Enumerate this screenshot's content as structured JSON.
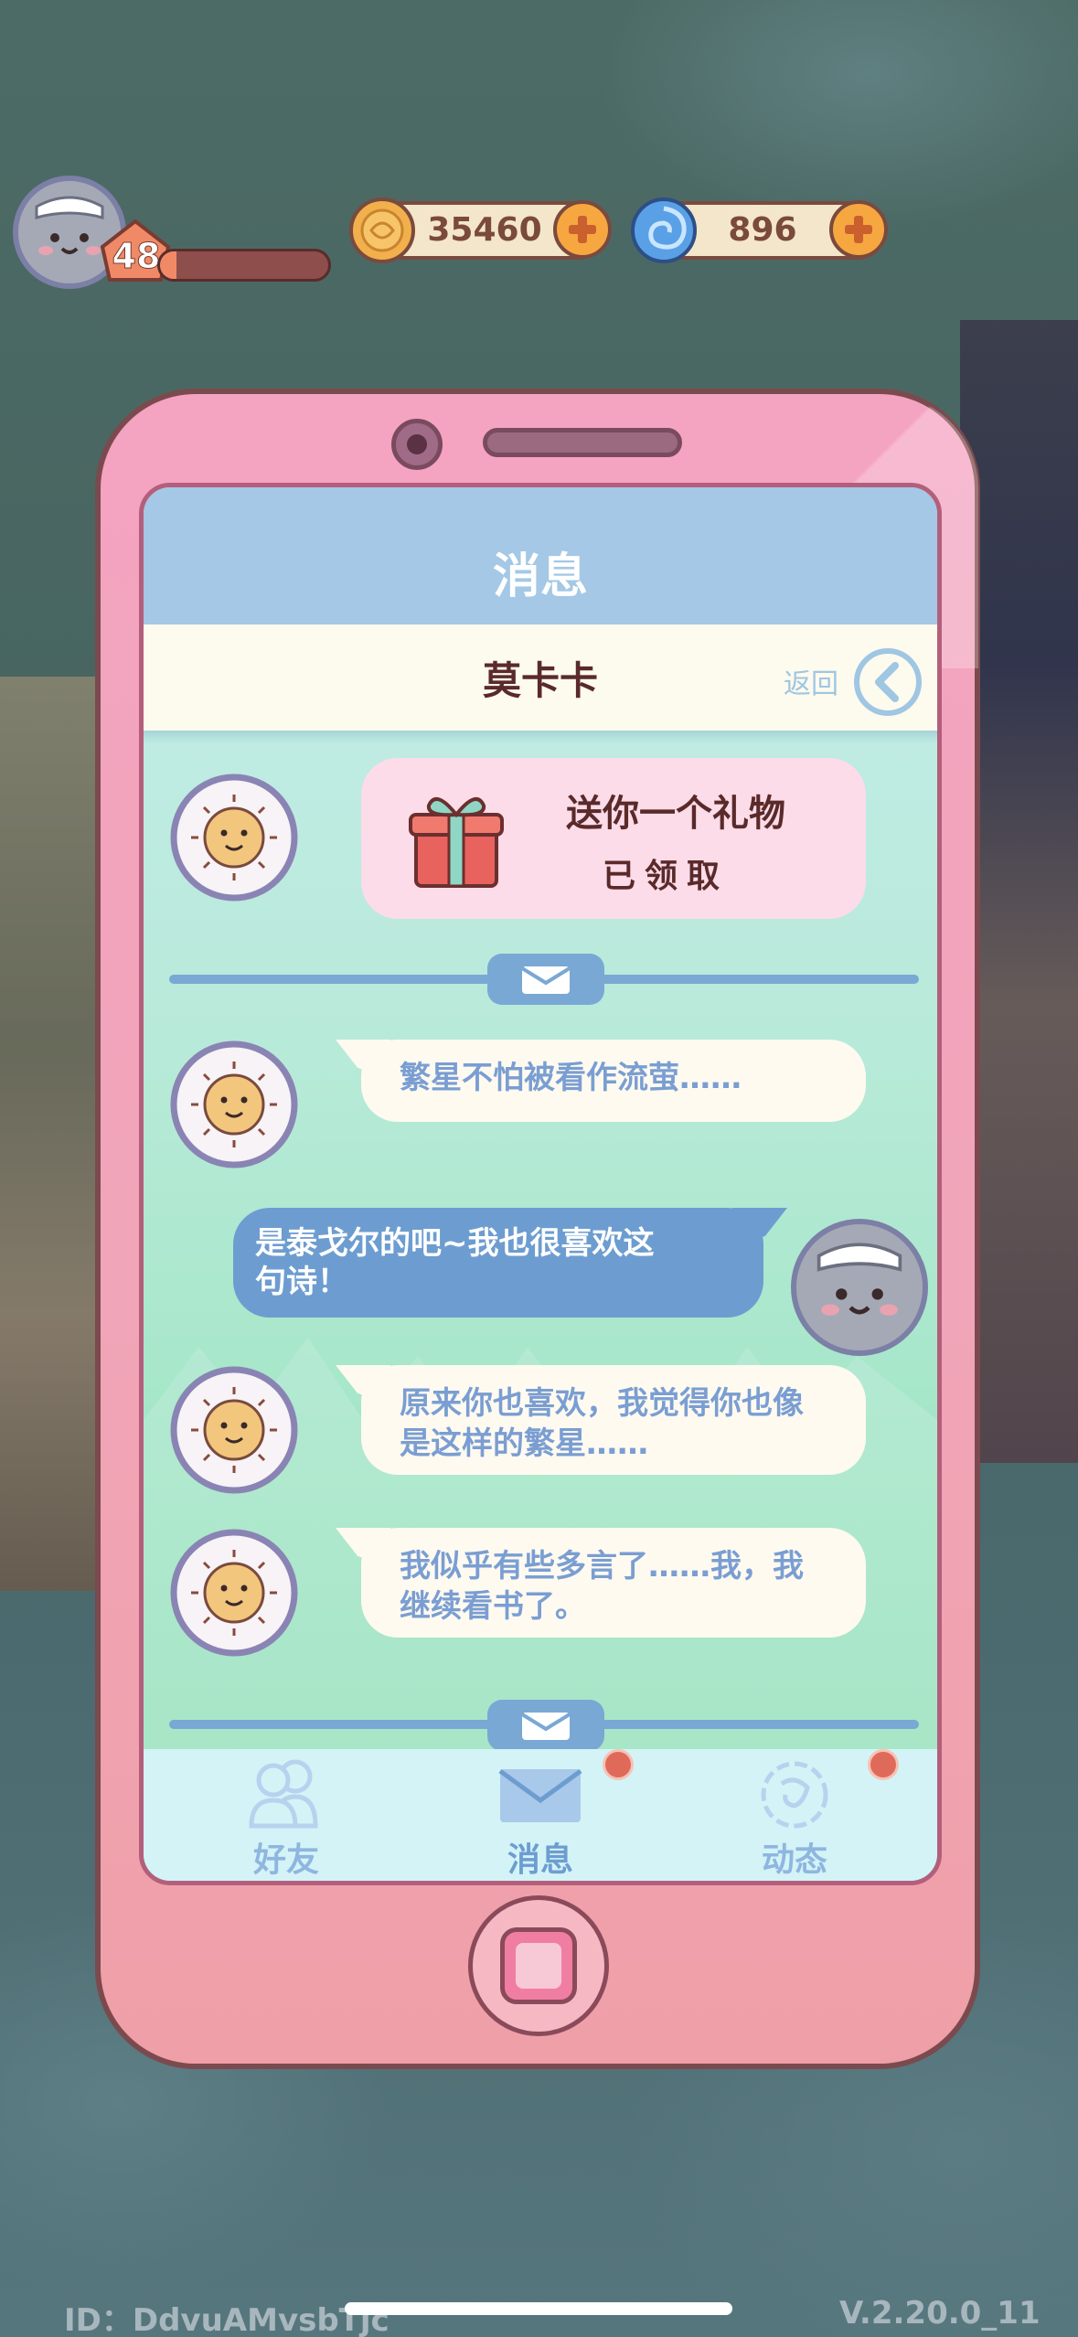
{
  "hud": {
    "level": "48",
    "xp_progress": 0.1,
    "coins": "35460",
    "gems": "896"
  },
  "phone": {
    "title": "消息",
    "contact_name": "莫卡卡",
    "back_label": "返回"
  },
  "messages": [
    {
      "type": "gift",
      "title": "送你一个礼物",
      "status": "已领取"
    },
    {
      "type": "npc",
      "lines": [
        "繁星不怕被看作流萤……"
      ]
    },
    {
      "type": "player",
      "lines": [
        "是泰戈尔的吧~我也很喜欢这",
        "句诗！"
      ]
    },
    {
      "type": "npc",
      "lines": [
        "原来你也喜欢，我觉得你也像",
        "是这样的繁星……"
      ]
    },
    {
      "type": "npc",
      "lines": [
        "我似乎有些多言了……我，我",
        "继续看书了。"
      ]
    }
  ],
  "tabs": [
    {
      "label": "好友",
      "icon": "friends-icon",
      "active": false,
      "badge": false
    },
    {
      "label": "消息",
      "icon": "mail-icon",
      "active": true,
      "badge": true
    },
    {
      "label": "动态",
      "icon": "moments-icon",
      "active": false,
      "badge": true
    }
  ],
  "footer": {
    "id_text": "ID：DdvuAMvsbTjc",
    "version": "V.2.20.0_11"
  },
  "colors": {
    "phone_pink": "#f4a3c1",
    "title_bar": "#a4c8e6",
    "player_bubble": "#6d9dd0",
    "npc_text": "#7a9ed2",
    "badge_red": "#e06a5a"
  }
}
